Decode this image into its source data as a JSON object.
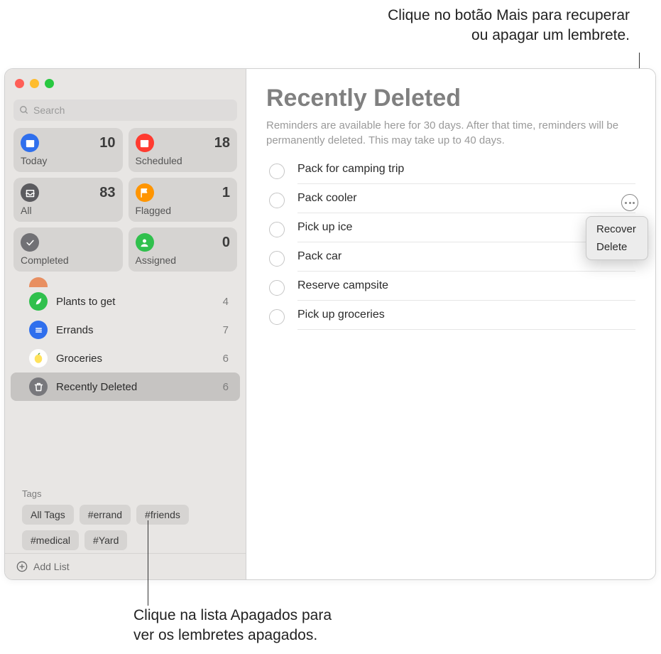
{
  "callouts": {
    "top_line1": "Clique no botão Mais para recuperar",
    "top_line2": "ou apagar um lembrete.",
    "bottom_line1": "Clique na lista Apagados para",
    "bottom_line2": "ver os lembretes apagados."
  },
  "search": {
    "placeholder": "Search"
  },
  "smart": [
    {
      "label": "Today",
      "count": "10",
      "bg": "#2f6fed",
      "icon": "calendar"
    },
    {
      "label": "Scheduled",
      "count": "18",
      "bg": "#ff3b30",
      "icon": "calendar"
    },
    {
      "label": "All",
      "count": "83",
      "bg": "#5b5b5f",
      "icon": "tray"
    },
    {
      "label": "Flagged",
      "count": "1",
      "bg": "#ff9500",
      "icon": "flag"
    },
    {
      "label": "Completed",
      "count": "",
      "bg": "#717175",
      "icon": "check"
    },
    {
      "label": "Assigned",
      "count": "0",
      "bg": "#30c04d",
      "icon": "person"
    }
  ],
  "lists": [
    {
      "name": "Plants to get",
      "count": "4",
      "bg": "#30c04d",
      "icon": "leaf",
      "selected": false
    },
    {
      "name": "Errands",
      "count": "7",
      "bg": "#2f6fed",
      "icon": "lines",
      "selected": false
    },
    {
      "name": "Groceries",
      "count": "6",
      "bg": "#ffe25c",
      "icon": "lemon",
      "selected": false
    },
    {
      "name": "Recently Deleted",
      "count": "6",
      "bg": "#78787c",
      "icon": "trash",
      "selected": true
    }
  ],
  "tags": {
    "title": "Tags",
    "items": [
      "All Tags",
      "#errand",
      "#friends",
      "#medical",
      "#Yard"
    ]
  },
  "add_list": "Add List",
  "main": {
    "title": "Recently Deleted",
    "desc": "Reminders are available here for 30 days. After that time, reminders will be permanently deleted. This may take up to 40 days.",
    "items": [
      "Pack for camping trip",
      "Pack cooler",
      "Pick up ice",
      "Pack car",
      "Reserve campsite",
      "Pick up groceries"
    ]
  },
  "popover": {
    "recover": "Recover",
    "delete": "Delete"
  }
}
